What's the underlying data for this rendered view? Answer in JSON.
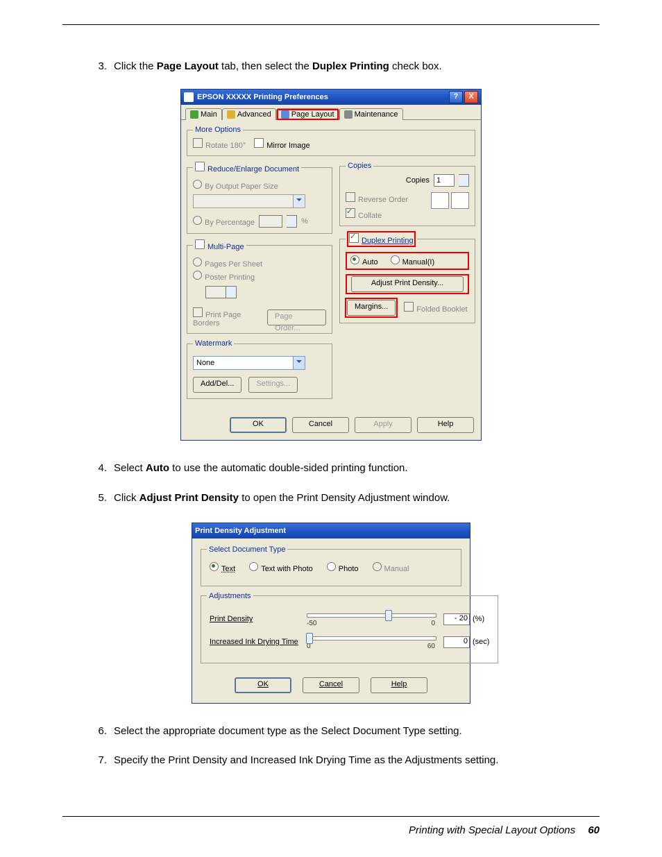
{
  "steps": {
    "s3_num": "3.",
    "s3_pre": "Click the ",
    "s3_b1": "Page Layout",
    "s3_mid": " tab, then select the ",
    "s3_b2": "Duplex Printing",
    "s3_post": " check box.",
    "s4_num": "4.",
    "s4_pre": "Select ",
    "s4_b1": "Auto",
    "s4_post": " to use the automatic double-sided printing function.",
    "s5_num": "5.",
    "s5_pre": "Click ",
    "s5_b1": "Adjust Print Density",
    "s5_post": " to open the Print Density Adjustment window.",
    "s6_num": "6.",
    "s6_text": "Select the appropriate document type as the Select Document Type setting.",
    "s7_num": "7.",
    "s7_text": "Specify the Print Density and Increased Ink Drying Time as the Adjustments setting."
  },
  "dlg1": {
    "title": "EPSON   XXXXX   Printing Preferences",
    "help_btn": "?",
    "close_btn": "X",
    "tabs": {
      "main": "Main",
      "advanced": "Advanced",
      "page_layout": "Page Layout",
      "maintenance": "Maintenance"
    },
    "more_options": {
      "legend": "More Options",
      "rotate": "Rotate 180°",
      "mirror": "Mirror Image"
    },
    "reduce": {
      "legend": "Reduce/Enlarge Document",
      "by_output": "By Output Paper Size",
      "by_percent": "By Percentage",
      "percent_unit": "%"
    },
    "multi": {
      "legend": "Multi-Page",
      "pps": "Pages Per Sheet",
      "poster": "Poster Printing",
      "borders": "Print Page Borders",
      "page_order": "Page Order..."
    },
    "copies": {
      "legend": "Copies",
      "label": "Copies",
      "value": "1",
      "reverse": "Reverse Order",
      "collate": "Collate"
    },
    "duplex": {
      "legend": "Duplex Printing",
      "auto": "Auto",
      "manual": "Manual(I)",
      "adjust": "Adjust Print Density...",
      "margins": "Margins...",
      "booklet": "Folded Booklet"
    },
    "watermark": {
      "legend": "Watermark",
      "none": "None",
      "add_del": "Add/Del...",
      "settings": "Settings..."
    },
    "footer": {
      "ok": "OK",
      "cancel": "Cancel",
      "apply": "Apply",
      "help": "Help"
    }
  },
  "dlg2": {
    "title": "Print Density Adjustment",
    "select_type": {
      "legend": "Select Document Type",
      "text": "Text",
      "text_photo": "Text with Photo",
      "photo": "Photo",
      "manual": "Manual"
    },
    "adjustments": {
      "legend": "Adjustments",
      "density_label": "Print Density",
      "density_min": "-50",
      "density_max": "0",
      "density_val": "- 20",
      "density_unit": "(%)",
      "dry_label": "Increased Ink Drying Time",
      "dry_min": "0",
      "dry_max": "60",
      "dry_val": "0",
      "dry_unit": "(sec)"
    },
    "footer": {
      "ok": "OK",
      "cancel": "Cancel",
      "help": "Help"
    }
  },
  "page_footer": {
    "section": "Printing with Special Layout Options",
    "page": "60"
  }
}
